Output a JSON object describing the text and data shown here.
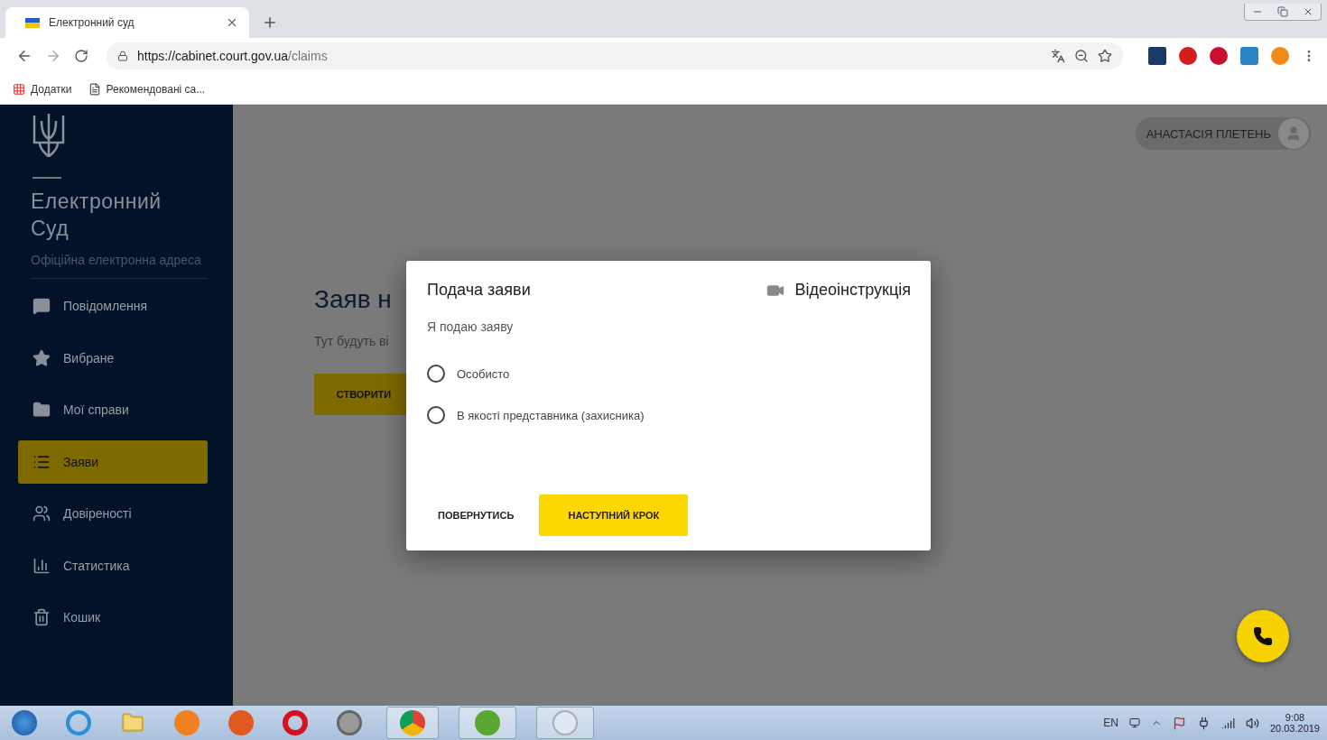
{
  "browser": {
    "tabs": [
      {
        "title": "Електронний суд",
        "selected": true
      }
    ],
    "url": {
      "host": "https://cabinet.court.gov.ua",
      "path": "/claims"
    },
    "bookmarks": [
      {
        "kind": "apps",
        "label": "Додатки"
      },
      {
        "kind": "page",
        "label": "Рекомендовані са..."
      }
    ]
  },
  "sidebar": {
    "title": "Електронний Суд",
    "subtitle": "Офіційна електронна адреса",
    "items": [
      {
        "label": "Повідомлення",
        "selected": false
      },
      {
        "label": "Вибране",
        "selected": false
      },
      {
        "label": "Мої справи",
        "selected": false
      },
      {
        "label": "Заяви",
        "selected": true
      },
      {
        "label": "Довіреності",
        "selected": false
      },
      {
        "label": "Статистика",
        "selected": false
      },
      {
        "label": "Кошик",
        "selected": false
      }
    ]
  },
  "user": {
    "name": "АНАСТАСІЯ ПЛЕТЕНЬ"
  },
  "main": {
    "heading": "Заяв н",
    "text": "Тут будуть ві",
    "button": "СТВОРИТИ"
  },
  "dialog": {
    "title": "Подача заяви",
    "video_link": "Відеоінструкція",
    "prompt": "Я подаю заяву",
    "options": [
      {
        "label": "Особисто",
        "selected": false
      },
      {
        "label": "В якості представника (захисника)",
        "selected": false
      }
    ],
    "back_button": "ПОВЕРНУТИСЬ",
    "next_button": "НАСТУПНИЙ КРОК"
  },
  "taskbar": {
    "language": "EN",
    "time": "9:08",
    "date": "20.03.2019"
  }
}
